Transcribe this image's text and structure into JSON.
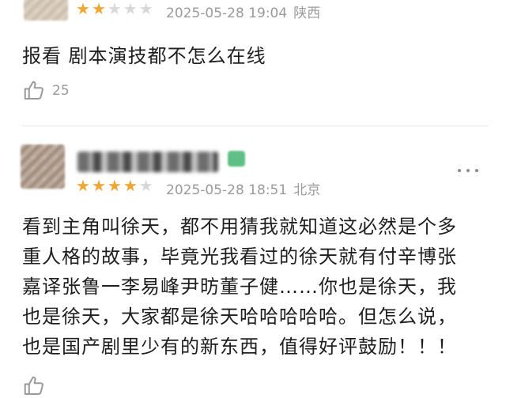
{
  "reviews": [
    {
      "rating": 2,
      "max_rating": 5,
      "date": "2025-05-28 19:04",
      "location": "陕西",
      "text": "报看 剧本演技都不怎么在线",
      "likes": "25"
    },
    {
      "rating": 4,
      "max_rating": 5,
      "date": "2025-05-28 18:51",
      "location": "北京",
      "text_lines": [
        "看到主角叫徐天，都不用猜我就知道这必然是个多",
        "重人格的故事，毕竟光我看过的徐天就有付辛博张",
        "嘉译张鲁一李易峰尹昉董子健……你也是徐天，我",
        "也是徐天，大家都是徐天哈哈哈哈哈。但怎么说，",
        "也是国产剧里少有的新东西，值得好评鼓励！！！"
      ]
    }
  ],
  "icons": {
    "star": "★",
    "like": "thumbs-up-icon",
    "more": "more-icon"
  },
  "colors": {
    "star_full": "#f2a531",
    "star_empty": "#d8d8d8",
    "meta": "#9a9a9a"
  }
}
